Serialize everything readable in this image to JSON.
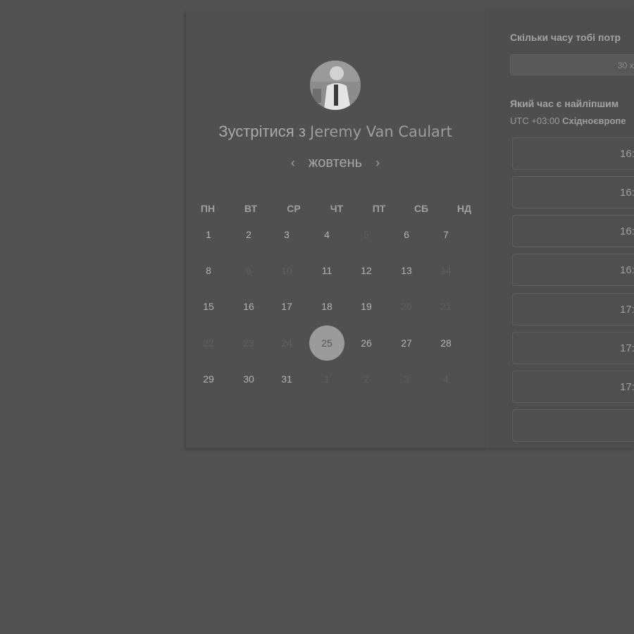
{
  "scheduler": {
    "title_prefix": "Зустрітися з",
    "host_name": "Jeremy Van Caulart",
    "month": "жовтень",
    "prev_icon": "chevron-left-icon",
    "next_icon": "chevron-right-icon",
    "weekdays": [
      "ПН",
      "ВТ",
      "СР",
      "ЧТ",
      "ПТ",
      "СБ",
      "НД"
    ],
    "weeks": [
      [
        {
          "d": "1",
          "m": false
        },
        {
          "d": "2",
          "m": false
        },
        {
          "d": "3",
          "m": false
        },
        {
          "d": "4",
          "m": false
        },
        {
          "d": "5",
          "m": true
        },
        {
          "d": "6",
          "m": false
        },
        {
          "d": "7",
          "m": false
        }
      ],
      [
        {
          "d": "8",
          "m": false
        },
        {
          "d": "9",
          "m": true
        },
        {
          "d": "10",
          "m": true
        },
        {
          "d": "11",
          "m": false
        },
        {
          "d": "12",
          "m": false
        },
        {
          "d": "13",
          "m": false
        },
        {
          "d": "14",
          "m": true
        }
      ],
      [
        {
          "d": "15",
          "m": false
        },
        {
          "d": "16",
          "m": false
        },
        {
          "d": "17",
          "m": false
        },
        {
          "d": "18",
          "m": false
        },
        {
          "d": "19",
          "m": false
        },
        {
          "d": "20",
          "m": true
        },
        {
          "d": "21",
          "m": true
        }
      ],
      [
        {
          "d": "22",
          "m": true
        },
        {
          "d": "23",
          "m": true
        },
        {
          "d": "24",
          "m": true
        },
        {
          "d": "25",
          "m": false,
          "selected": true
        },
        {
          "d": "26",
          "m": false
        },
        {
          "d": "27",
          "m": false
        },
        {
          "d": "28",
          "m": false
        }
      ],
      [
        {
          "d": "29",
          "m": false
        },
        {
          "d": "30",
          "m": false
        },
        {
          "d": "31",
          "m": false
        },
        {
          "d": "1",
          "m": true
        },
        {
          "d": "2",
          "m": true
        },
        {
          "d": "3",
          "m": true
        },
        {
          "d": "4",
          "m": true
        }
      ]
    ]
  },
  "booking": {
    "duration_label": "Скільки часу тобі потр",
    "duration_value": "30 х",
    "time_label": "Який час є найліпшим",
    "timezone_offset": "UTC +03:00",
    "timezone_name": "Східноєвропе",
    "slots": [
      "16:",
      "16:",
      "16:",
      "16:",
      "17:",
      "17:",
      "17:"
    ]
  }
}
